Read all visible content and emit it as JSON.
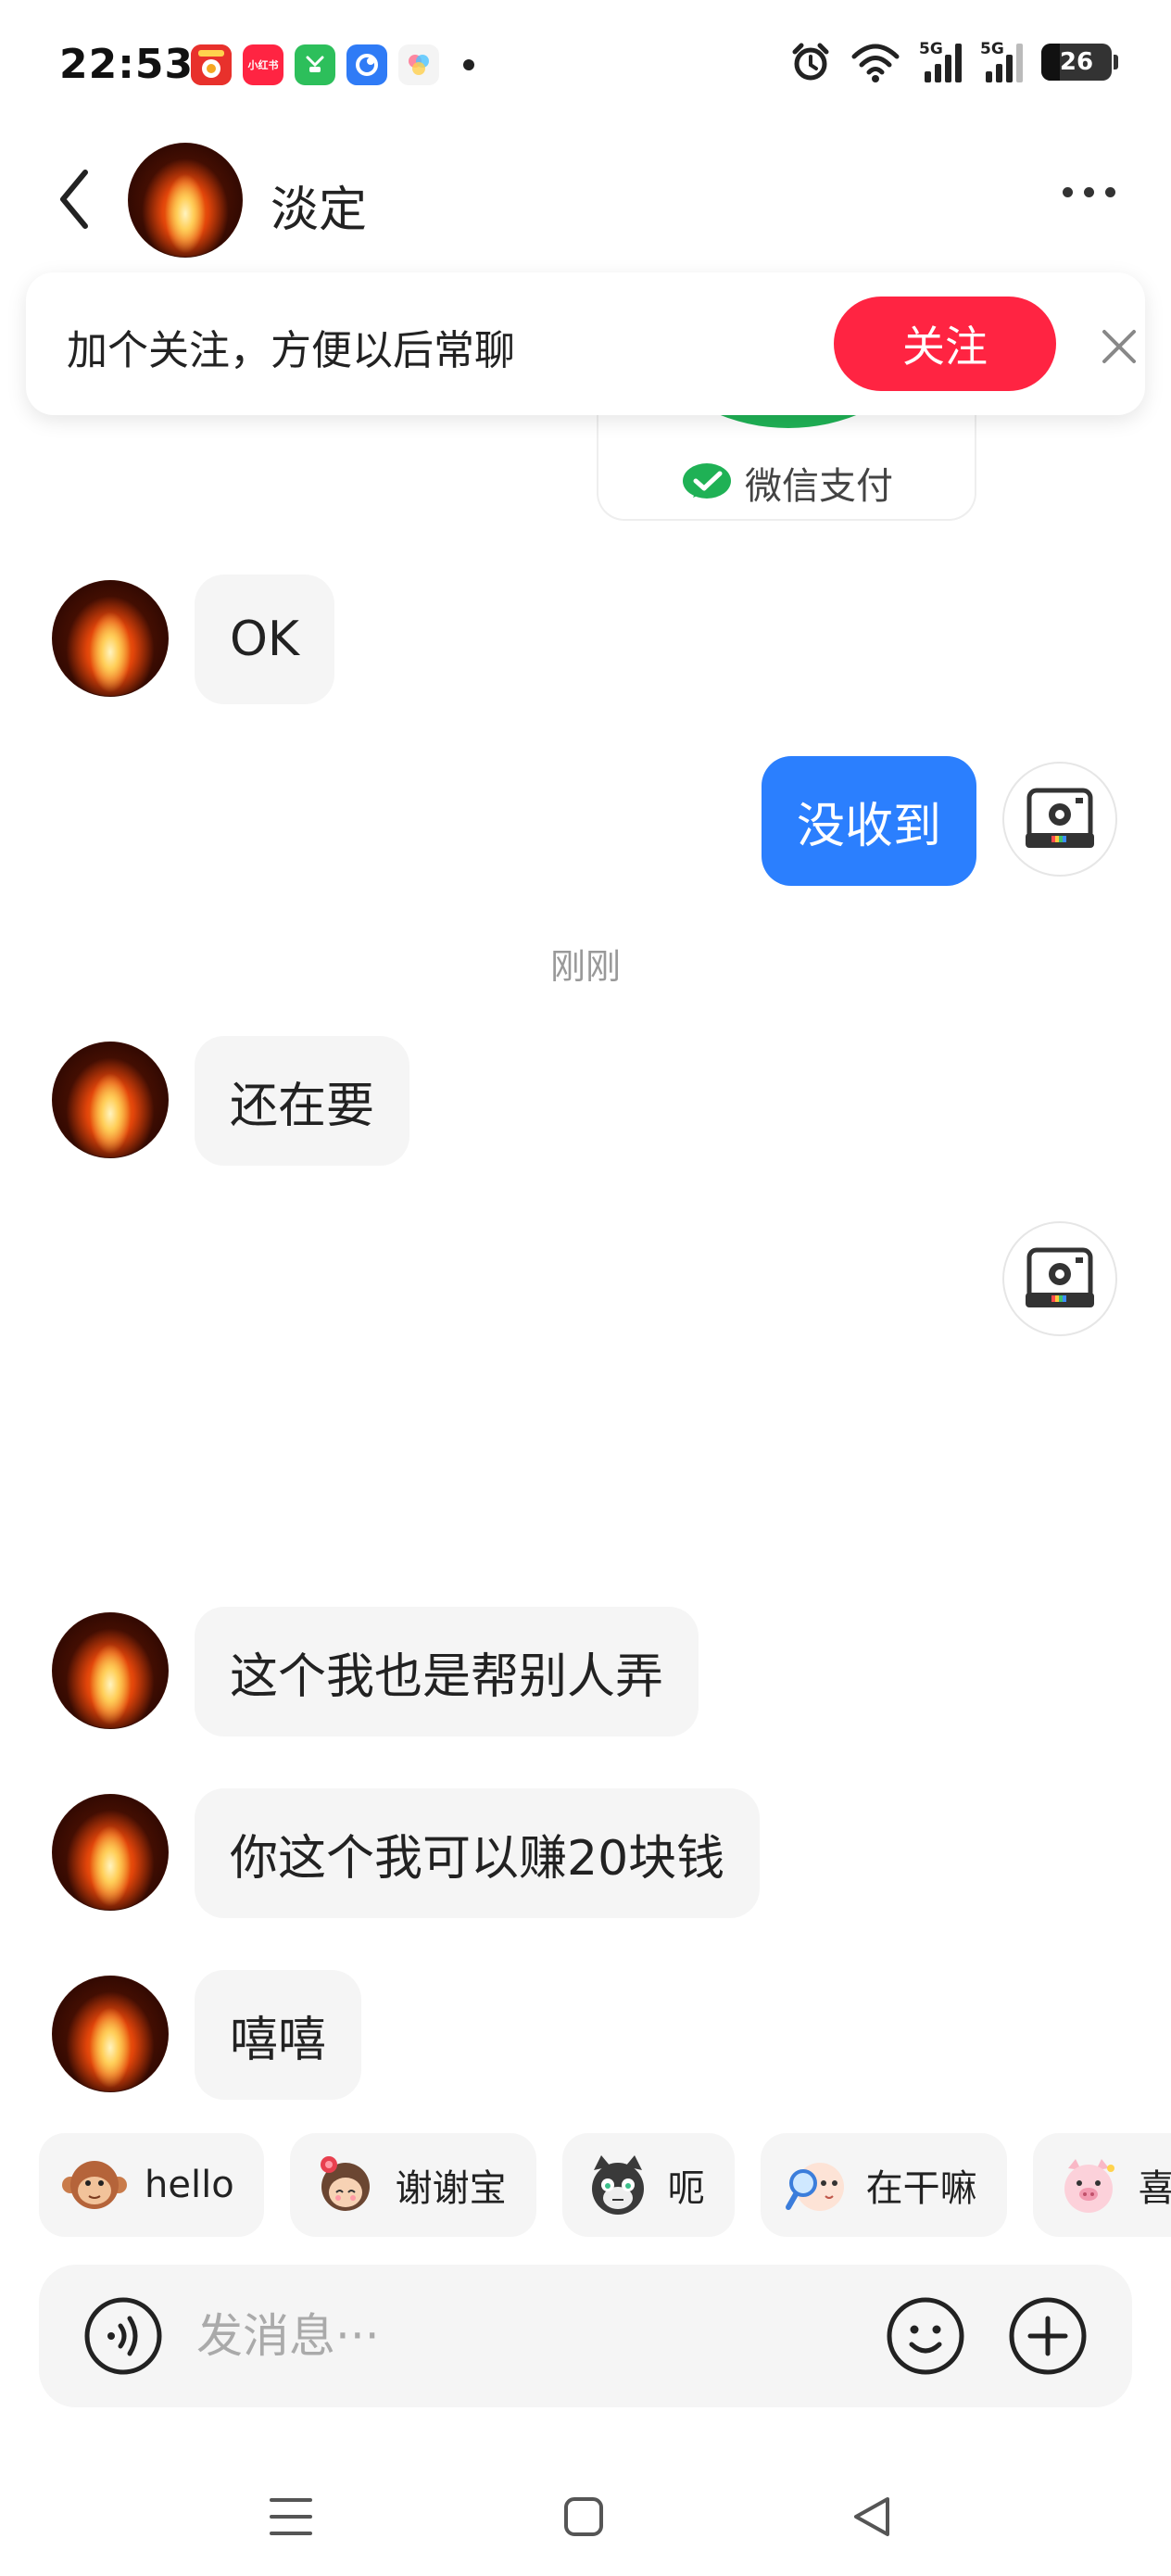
{
  "status_bar": {
    "time": "22:53",
    "app_icons": [
      {
        "name": "takeout-app-icon",
        "label": "",
        "color": "#e8312c"
      },
      {
        "name": "xiaohongshu-app-icon",
        "label": "小红书",
        "color": "#ff2442"
      },
      {
        "name": "green-app-icon",
        "label": "",
        "color": "#2dbf5b"
      },
      {
        "name": "blue-app-icon",
        "label": "",
        "color": "#2f7bf6"
      },
      {
        "name": "colorful-app-icon",
        "label": "",
        "color": "#f4f4f4"
      }
    ],
    "signal_1_tag": "5G",
    "signal_2_tag": "5G",
    "battery": "26"
  },
  "header": {
    "contact_name": "淡定"
  },
  "follow_bar": {
    "text": "加个关注，方便以后常聊",
    "button_label": "关注"
  },
  "pay_card": {
    "label": "微信支付",
    "accent": "#1fb155"
  },
  "messages": [
    {
      "direction": "in",
      "text": "OK"
    },
    {
      "direction": "out",
      "text": "没收到"
    },
    {
      "direction": "time",
      "text": "刚刚"
    },
    {
      "direction": "in",
      "text": "还在要"
    },
    {
      "direction": "out",
      "text": ""
    },
    {
      "direction": "in",
      "text": "这个我也是帮别人弄"
    },
    {
      "direction": "in",
      "text": "你这个我可以赚20块钱"
    },
    {
      "direction": "in",
      "text": "嘻嘻"
    }
  ],
  "quick_replies": [
    {
      "label": "hello",
      "icon": "monkey-sticker-icon"
    },
    {
      "label": "谢谢宝",
      "icon": "girl-flower-sticker-icon"
    },
    {
      "label": "呃",
      "icon": "cat-sticker-icon"
    },
    {
      "label": "在干嘛",
      "icon": "magnifier-sticker-icon"
    },
    {
      "label": "喜",
      "icon": "pig-sticker-icon"
    }
  ],
  "input": {
    "placeholder": "发消息···"
  },
  "colors": {
    "bubble_out": "#2b7ffe",
    "bubble_in": "#f5f5f5",
    "follow_button": "#ff2442"
  }
}
